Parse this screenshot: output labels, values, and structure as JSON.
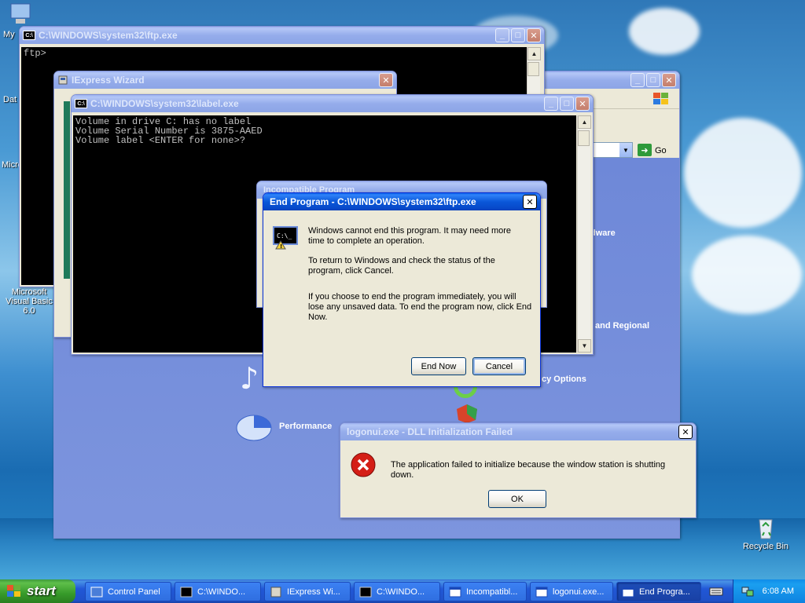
{
  "desktop": {
    "icons": [
      {
        "label": "My"
      },
      {
        "label": "Dat"
      },
      {
        "label": "Micro"
      },
      {
        "label": "Microsoft Visual Basic 6.0"
      },
      {
        "label": "Recycle Bin"
      }
    ]
  },
  "ftp_window": {
    "title": "C:\\WINDOWS\\system32\\ftp.exe",
    "content": "ftp>"
  },
  "iexpress_window": {
    "title": "IExpress Wizard"
  },
  "label_window": {
    "title": "C:\\WINDOWS\\system32\\label.exe",
    "content": "Volume in drive C: has no label\nVolume Serial Number is 3875-AAED\nVolume label <ENTER for none>?"
  },
  "control_panel": {
    "go_label": "Go",
    "items": [
      {
        "label": "dware"
      },
      {
        "label": "and Regional"
      },
      {
        "label": "cy Options"
      },
      {
        "label": "Performance"
      }
    ]
  },
  "incompatible_window": {
    "title": "Incompatible Program"
  },
  "end_program_dialog": {
    "title": "End Program - C:\\WINDOWS\\system32\\ftp.exe",
    "paragraph1": "Windows cannot end this program. It may need more time to complete an operation.",
    "paragraph2": "To return to Windows and check the status of the program, click Cancel.",
    "paragraph3": "If you choose to end the program immediately, you will lose any unsaved data. To end the program now, click End Now.",
    "end_now_label": "End Now",
    "cancel_label": "Cancel"
  },
  "logonui_dialog": {
    "title": "logonui.exe - DLL Initialization Failed",
    "message": "The application failed to initialize because the window station is shutting down.",
    "ok_label": "OK"
  },
  "taskbar": {
    "start_label": "start",
    "tasks": [
      {
        "label": "Control Panel"
      },
      {
        "label": "C:\\WINDO..."
      },
      {
        "label": "IExpress Wi..."
      },
      {
        "label": "C:\\WINDO..."
      },
      {
        "label": "Incompatibl..."
      },
      {
        "label": "logonui.exe..."
      },
      {
        "label": "End Progra..."
      }
    ],
    "clock": "6:08 AM"
  }
}
